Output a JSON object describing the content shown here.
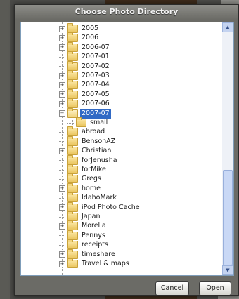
{
  "dialog": {
    "title": "Choose Photo Directory",
    "cancel_label": "Cancel",
    "open_label": "Open"
  },
  "tree": {
    "items": [
      {
        "label": "2005",
        "expander": "+",
        "open": false,
        "selected": false
      },
      {
        "label": "2006",
        "expander": "+",
        "open": false,
        "selected": false
      },
      {
        "label": "2006-07",
        "expander": "+",
        "open": false,
        "selected": false
      },
      {
        "label": "2007-01",
        "expander": "",
        "open": false,
        "selected": false
      },
      {
        "label": "2007-02",
        "expander": "",
        "open": false,
        "selected": false
      },
      {
        "label": "2007-03",
        "expander": "+",
        "open": false,
        "selected": false
      },
      {
        "label": "2007-04",
        "expander": "+",
        "open": false,
        "selected": false
      },
      {
        "label": "2007-05",
        "expander": "+",
        "open": false,
        "selected": false
      },
      {
        "label": "2007-06",
        "expander": "+",
        "open": false,
        "selected": false
      },
      {
        "label": "2007-07",
        "expander": "−",
        "open": true,
        "selected": true
      },
      {
        "label": "small",
        "expander": "",
        "open": false,
        "selected": false,
        "child": true
      },
      {
        "label": "abroad",
        "expander": "",
        "open": false,
        "selected": false
      },
      {
        "label": "BensonAZ",
        "expander": "",
        "open": false,
        "selected": false
      },
      {
        "label": "Christian",
        "expander": "+",
        "open": false,
        "selected": false
      },
      {
        "label": "forJenusha",
        "expander": "",
        "open": false,
        "selected": false
      },
      {
        "label": "forMike",
        "expander": "",
        "open": false,
        "selected": false
      },
      {
        "label": "Gregs",
        "expander": "",
        "open": false,
        "selected": false
      },
      {
        "label": "home",
        "expander": "+",
        "open": false,
        "selected": false
      },
      {
        "label": "IdahoMark",
        "expander": "",
        "open": false,
        "selected": false
      },
      {
        "label": "iPod Photo Cache",
        "expander": "+",
        "open": false,
        "selected": false
      },
      {
        "label": "Japan",
        "expander": "",
        "open": false,
        "selected": false
      },
      {
        "label": "Morella",
        "expander": "+",
        "open": false,
        "selected": false
      },
      {
        "label": "Pennys",
        "expander": "",
        "open": false,
        "selected": false
      },
      {
        "label": "receipts",
        "expander": "",
        "open": false,
        "selected": false
      },
      {
        "label": "timeshare",
        "expander": "+",
        "open": false,
        "selected": false
      },
      {
        "label": "Travel & maps",
        "expander": "+",
        "open": false,
        "selected": false
      }
    ]
  },
  "scrollbar": {
    "up_icon": "scroll-up-arrow",
    "down_icon": "scroll-down-arrow",
    "thumb_start": 0.59,
    "thumb_fraction": 0.41
  },
  "colors": {
    "selection": "#316ac5",
    "folder": "#e9c45c"
  }
}
